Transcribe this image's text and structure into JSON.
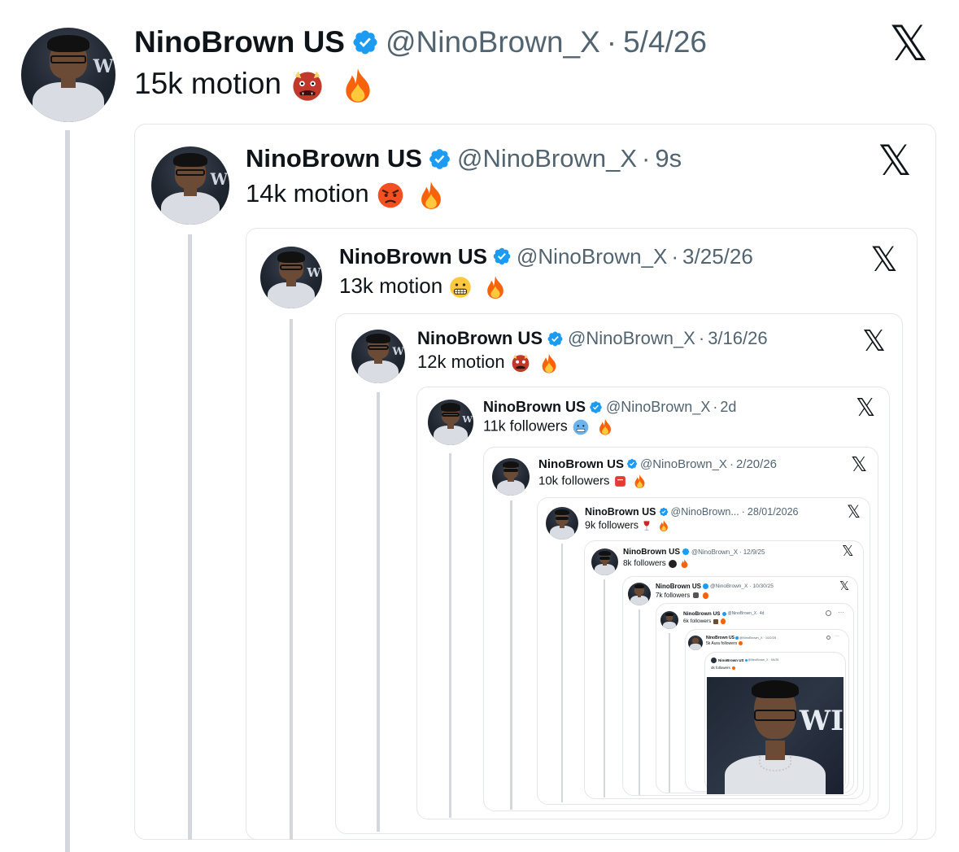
{
  "top_post": {
    "name": "NinoBrown US",
    "handle": "@NinoBrown_X",
    "sep": "·",
    "time": "5/4/26",
    "text": "15k motion"
  },
  "quotes": [
    {
      "name": "NinoBrown US",
      "handle": "@NinoBrown_X",
      "sep": "·",
      "time": "9s",
      "text": "14k motion"
    },
    {
      "name": "NinoBrown US",
      "handle": "@NinoBrown_X",
      "sep": "·",
      "time": "3/25/26",
      "text": "13k motion"
    },
    {
      "name": "NinoBrown US",
      "handle": "@NinoBrown_X",
      "sep": "·",
      "time": "3/16/26",
      "text": "12k motion"
    },
    {
      "name": "NinoBrown US",
      "handle": "@NinoBrown_X",
      "sep": "·",
      "time": "2d",
      "text": "11k followers"
    },
    {
      "name": "NinoBrown US",
      "handle": "@NinoBrown_X",
      "sep": "·",
      "time": "2/20/26",
      "text": "10k followers"
    },
    {
      "name": "NinoBrown US",
      "handle": "@NinoBrown...",
      "sep": "·",
      "time": "28/01/2026",
      "text": "9k followers"
    },
    {
      "name": "NinoBrown US",
      "handle": "@NinoBrown_X",
      "sep": "·",
      "time": "12/9/25",
      "text": "8k followers"
    },
    {
      "name": "NinoBrown US",
      "handle": "@NinoBrown_X",
      "sep": "·",
      "time": "10/30/25",
      "text": "7k followers"
    },
    {
      "name": "NinoBrown US",
      "handle": "@NinoBrown_X",
      "sep": "·",
      "time": "4d",
      "text": "6k followers"
    },
    {
      "name": "NinoBrown US",
      "handle": "@NinoBrown_X",
      "sep": "·",
      "time": "10/2/25",
      "text": "5k Aura followers"
    },
    {
      "name": "NinoBrown US",
      "handle": "@NinoBrown_X",
      "sep": "·",
      "time": "9/4/25",
      "text": "4k followers"
    }
  ],
  "icons": {
    "verified": "verified-badge-icon",
    "x_logo": "x-logo-icon",
    "fire": "fire-emoji",
    "ogre": "ogre-emoji",
    "angry": "angry-face-emoji",
    "grimace": "grimacing-face-emoji",
    "cold": "cold-face-emoji"
  },
  "colors": {
    "verified": "#1d9bf0",
    "handle": "#536471",
    "border": "#e3e6ea"
  }
}
